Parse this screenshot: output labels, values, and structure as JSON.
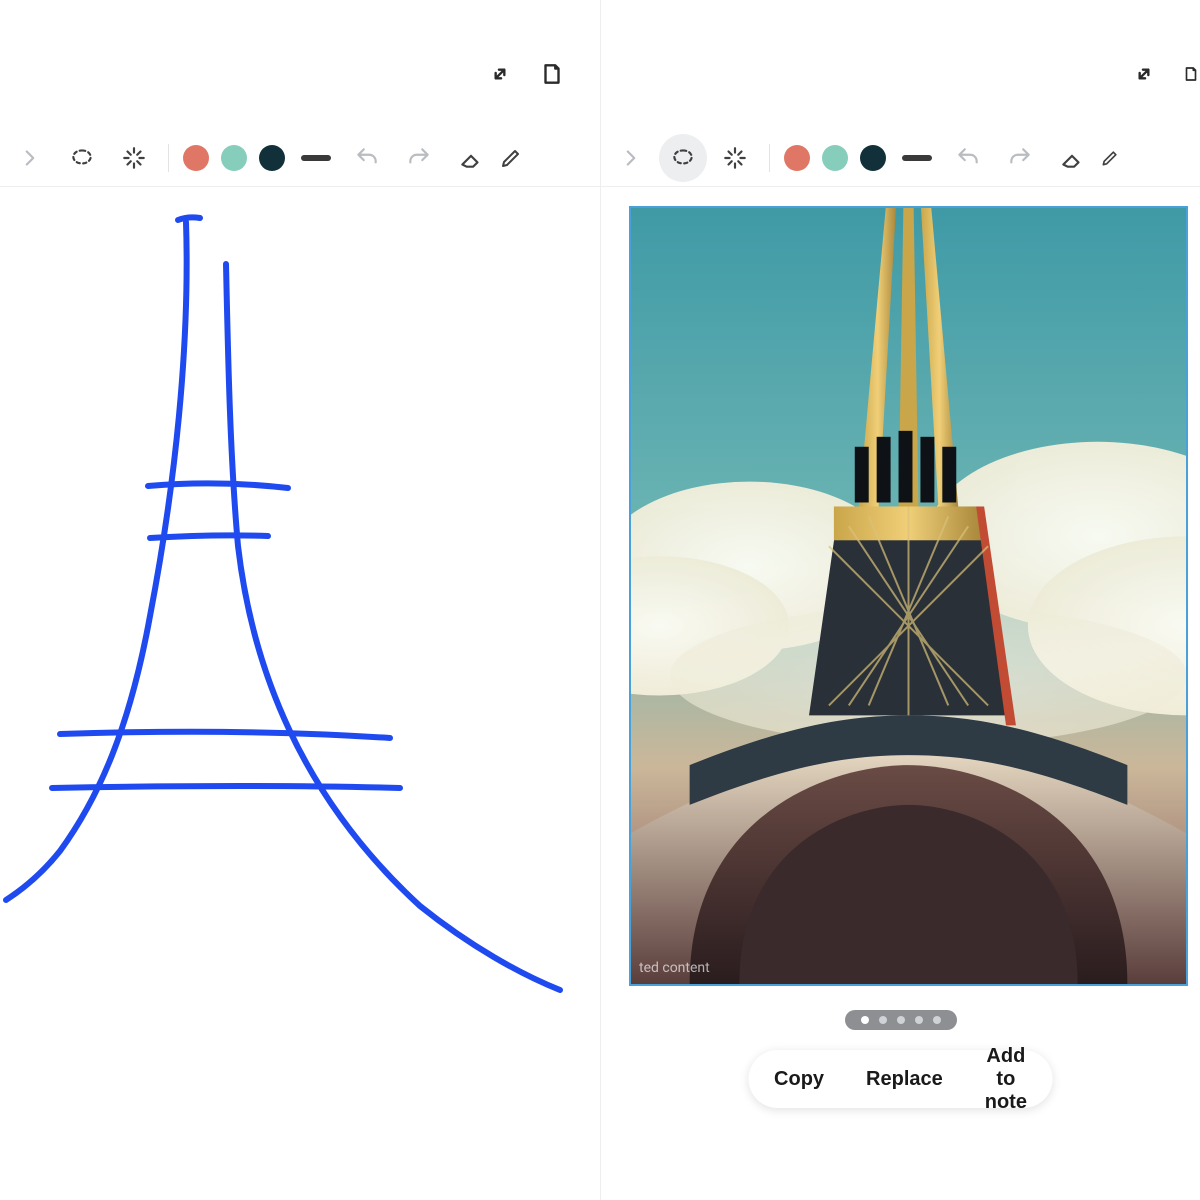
{
  "colors": {
    "salmon": "#e07766",
    "mint": "#86cdbb",
    "navy": "#12303a",
    "stroke_blue": "#1f4af0"
  },
  "toolbar": {
    "lasso_icon": "lasso",
    "ai_icon": "sparkle",
    "undo_icon": "undo",
    "redo_icon": "redo",
    "eraser_icon": "eraser",
    "pen_icon": "pen"
  },
  "window": {
    "expand_icon": "expand",
    "reader_icon": "reader"
  },
  "generated": {
    "watermark": "ted content"
  },
  "pager": {
    "count": 5,
    "active_index": 0
  },
  "actions": {
    "copy": "Copy",
    "replace": "Replace",
    "add": "Add to note"
  }
}
